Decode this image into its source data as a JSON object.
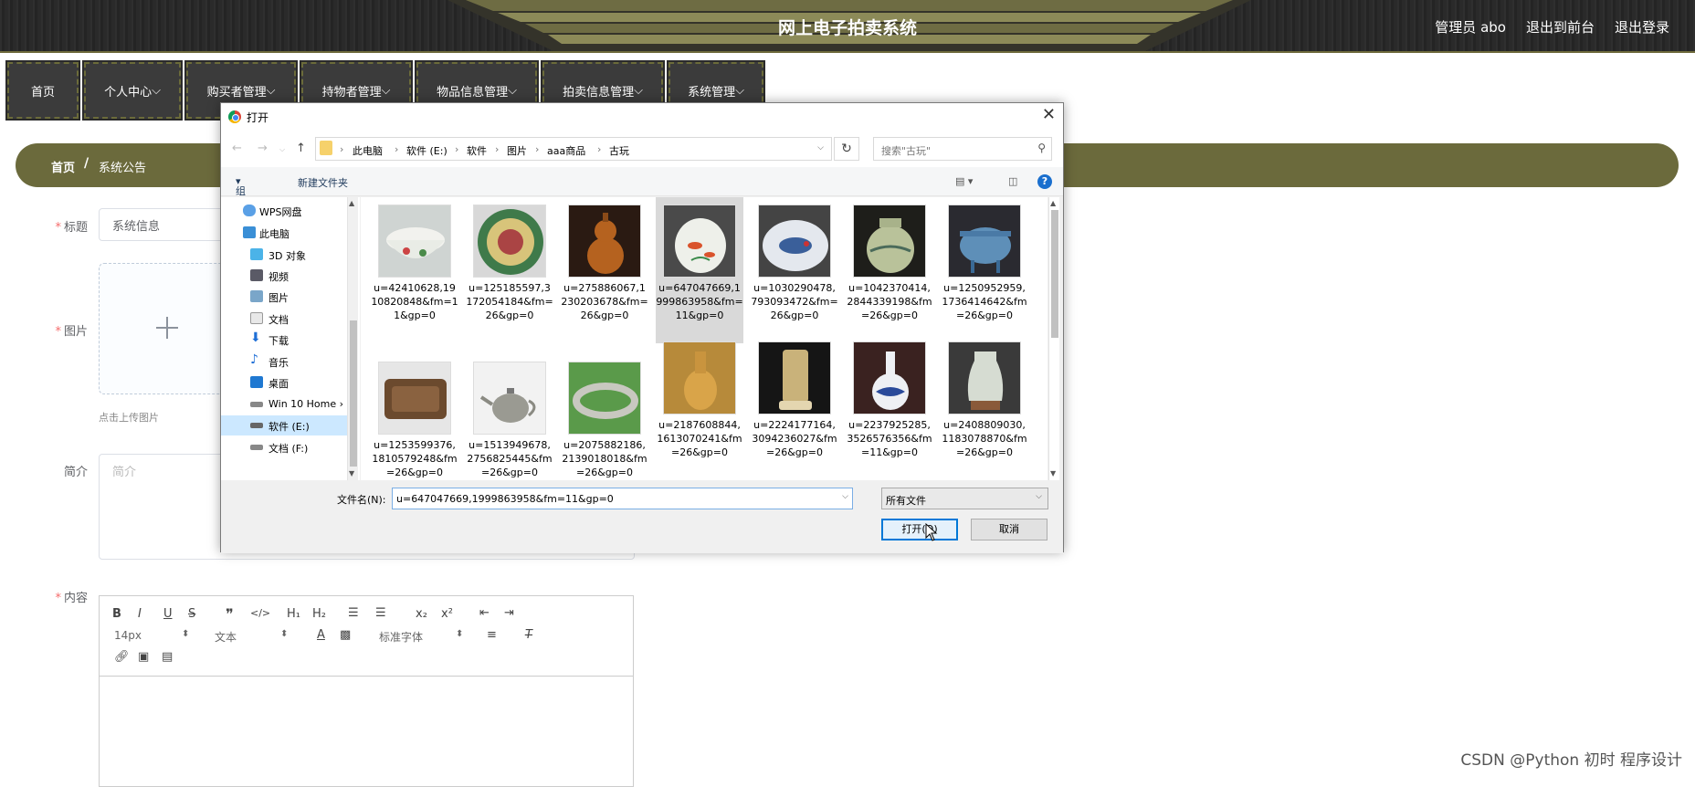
{
  "header": {
    "title": "网上电子拍卖系统",
    "links": [
      "管理员 abo",
      "退出到前台",
      "退出登录"
    ]
  },
  "nav": {
    "items": [
      "首页",
      "个人中心",
      "购买者管理",
      "持物者管理",
      "物品信息管理",
      "拍卖信息管理",
      "系统管理"
    ]
  },
  "breadcrumb": {
    "home": "首页",
    "separator": "/",
    "current": "系统公告"
  },
  "form": {
    "title_label": "标题",
    "title_value": "系统信息",
    "image_label": "图片",
    "upload_tip": "点击上传图片",
    "intro_label": "简介",
    "intro_placeholder": "简介",
    "content_label": "内容"
  },
  "editor": {
    "font_size": "14px",
    "block_type": "文本",
    "font_family": "标准字体",
    "buttons": [
      "B",
      "I",
      "U",
      "S",
      "❞",
      "</>",
      "H₁",
      "H₂",
      "x₂",
      "x²"
    ]
  },
  "dialog": {
    "title": "打开",
    "path": [
      "此电脑",
      "软件 (E:)",
      "软件",
      "图片",
      "aaa商品",
      "古玩"
    ],
    "search_placeholder": "搜索\"古玩\"",
    "organize": "组织",
    "new_folder": "新建文件夹",
    "tree": [
      {
        "label": "WPS网盘",
        "icon": "cloud-icon"
      },
      {
        "label": "此电脑",
        "icon": "computer-icon"
      },
      {
        "label": "3D 对象",
        "icon": "3d-objects-icon"
      },
      {
        "label": "视频",
        "icon": "video-folder-icon"
      },
      {
        "label": "图片",
        "icon": "pictures-folder-icon"
      },
      {
        "label": "文档",
        "icon": "documents-folder-icon"
      },
      {
        "label": "下载",
        "icon": "download-icon"
      },
      {
        "label": "音乐",
        "icon": "music-icon"
      },
      {
        "label": "桌面",
        "icon": "desktop-icon"
      },
      {
        "label": "Win 10 Home ›",
        "icon": "drive-icon"
      },
      {
        "label": "软件 (E:)",
        "icon": "drive-icon"
      },
      {
        "label": "文档 (F:)",
        "icon": "drive-icon"
      }
    ],
    "files": [
      "u=42410628,1910820848&fm=11&gp=0",
      "u=125185597,3172054184&fm=26&gp=0",
      "u=275886067,1230203678&fm=26&gp=0",
      "u=647047669,1999863958&fm=11&gp=0",
      "u=1030290478,793093472&fm=26&gp=0",
      "u=1042370414,2844339198&fm=26&gp=0",
      "u=1250952959,1736414642&fm=26&gp=0",
      "u=1253599376,1810579248&fm=26&gp=0",
      "u=1513949678,2756825445&fm=26&gp=0",
      "u=2075882186,2139018018&fm=26&gp=0",
      "u=2187608844,1613070241&fm=26&gp=0",
      "u=2224177164,3094236027&fm=26&gp=0",
      "u=2237925285,3526576356&fm=11&gp=0",
      "u=2408809030,1183078870&fm=26&gp=0"
    ],
    "filename_label": "文件名(N):",
    "filename_value": "u=647047669,1999863958&fm=11&gp=0",
    "filetype": "所有文件",
    "open_button": "打开(O)",
    "cancel_button": "取消"
  },
  "watermark": "CSDN @Python 初时 程序设计"
}
